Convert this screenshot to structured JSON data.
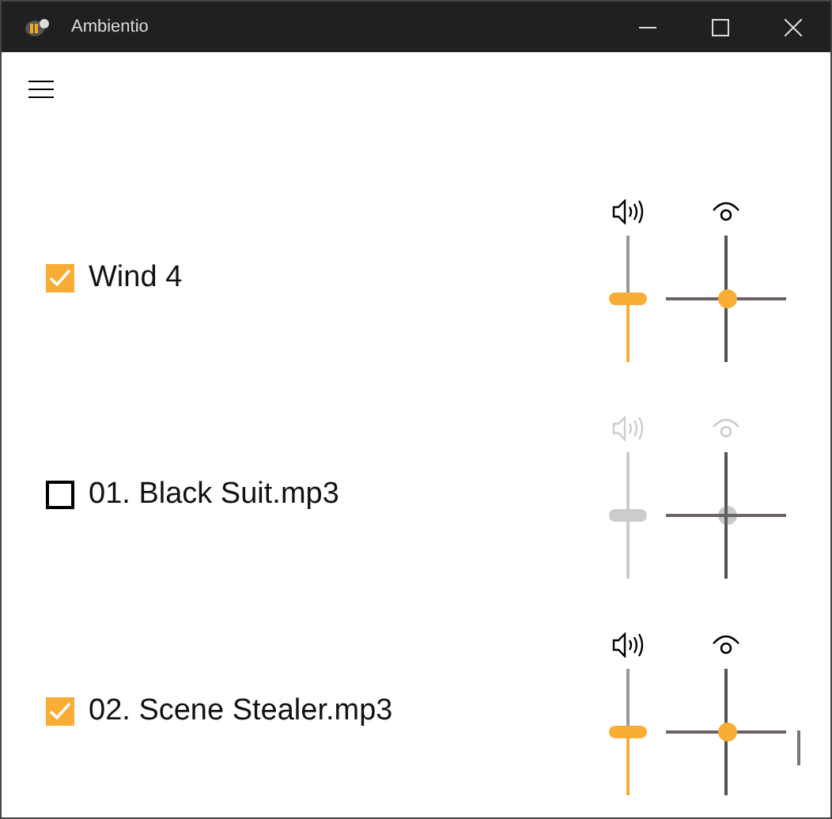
{
  "window": {
    "title": "Ambientio"
  },
  "sounds": [
    {
      "name": "Wind 4",
      "checked": true,
      "level": 0.5
    },
    {
      "name": "01. Black Suit.mp3",
      "checked": false,
      "level": 0.5
    },
    {
      "name": "02. Scene Stealer.mp3",
      "checked": true,
      "level": 0.5
    }
  ]
}
